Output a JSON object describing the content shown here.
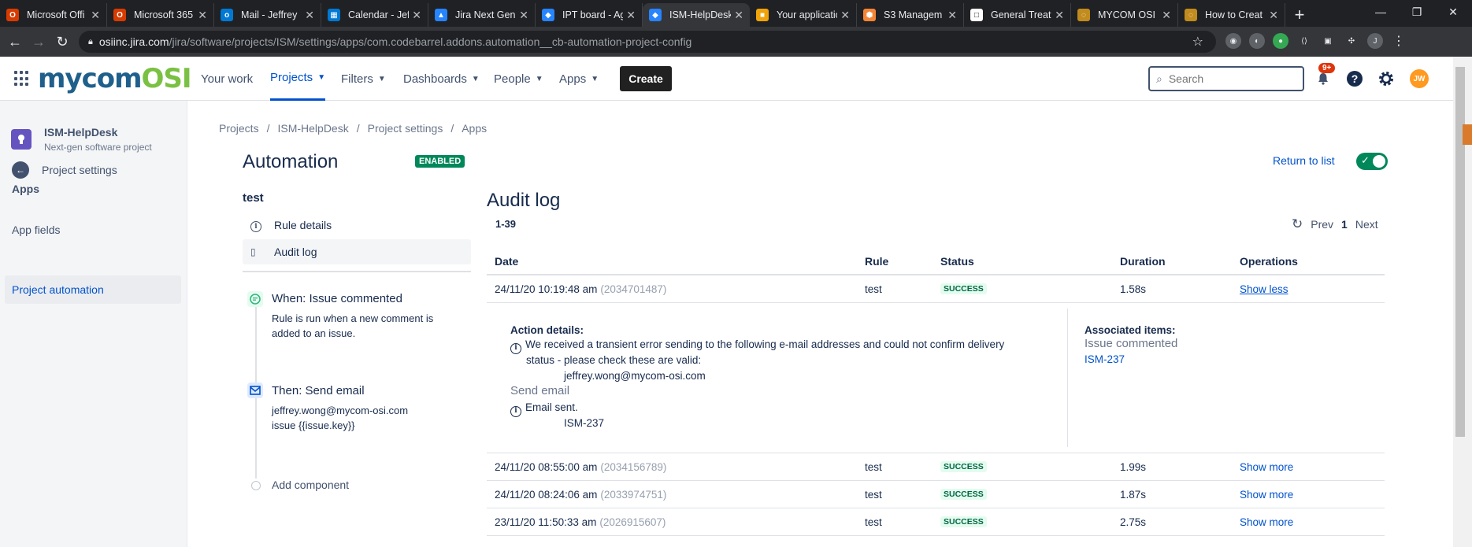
{
  "browser": {
    "tabs": [
      {
        "label": "Microsoft Offi",
        "color": "#d83b01",
        "glyph": "O"
      },
      {
        "label": "Microsoft 365",
        "color": "#d83b01",
        "glyph": "O"
      },
      {
        "label": "Mail - Jeffrey",
        "color": "#0078d4",
        "glyph": "o"
      },
      {
        "label": "Calendar - Jeff",
        "color": "#0078d4",
        "glyph": "▦"
      },
      {
        "label": "Jira Next Gen",
        "color": "#2684ff",
        "glyph": "▲"
      },
      {
        "label": "IPT board - Ag",
        "color": "#2684ff",
        "glyph": "◆"
      },
      {
        "label": "ISM-HelpDesk",
        "color": "#2684ff",
        "glyph": "◆"
      },
      {
        "label": "Your applicatio",
        "color": "#f0a30a",
        "glyph": "■"
      },
      {
        "label": "S3 Managem",
        "color": "#f58536",
        "glyph": "⬢"
      },
      {
        "label": "General Treat",
        "color": "#ffffff",
        "glyph": "□"
      },
      {
        "label": "MYCOM OSI",
        "color": "#c28b1e",
        "glyph": "◌"
      },
      {
        "label": "How to Creat",
        "color": "#c28b1e",
        "glyph": "◌"
      }
    ],
    "active_tab": 6,
    "url_host": "osiinc.jira.com",
    "url_path": "/jira/software/projects/ISM/settings/apps/com.codebarrel.addons.automation__cb-automation-project-config",
    "profile_initial": "J"
  },
  "topnav": {
    "logo_main": "mycom",
    "logo_accent": "OSI",
    "items": [
      "Your work",
      "Projects",
      "Filters",
      "Dashboards",
      "People",
      "Apps"
    ],
    "active_item": "Projects",
    "create_label": "Create",
    "search_placeholder": "Search",
    "notification_badge": "9+",
    "avatar_initials": "JW"
  },
  "sidebar": {
    "project_name": "ISM-HelpDesk",
    "project_type": "Next-gen software project",
    "back_label": "Project settings",
    "section_label": "Apps",
    "items": [
      "App fields",
      "Project automation"
    ],
    "selected_item": "Project automation"
  },
  "breadcrumb": [
    "Projects",
    "ISM-HelpDesk",
    "Project settings",
    "Apps"
  ],
  "automation": {
    "title": "Automation",
    "status_badge": "ENABLED",
    "return_label": "Return to list",
    "enabled": true,
    "rule_name": "test",
    "rule_menu": [
      {
        "label": "Rule details",
        "icon": "info-icon"
      },
      {
        "label": "Audit log",
        "icon": "document-icon"
      }
    ],
    "selected_menu": "Audit log",
    "components": [
      {
        "title": "When: Issue commented",
        "desc_lines": [
          "Rule is run when a new comment is",
          "added to an issue."
        ],
        "icon": "comment-icon",
        "icon_color": "#36b37e",
        "icon_bg": "#e3fcef"
      },
      {
        "title": "Then: Send email",
        "desc_lines": [
          "jeffrey.wong@mycom-osi.com",
          "issue {{issue.key}}"
        ],
        "icon": "email-icon",
        "icon_color": "#0052cc",
        "icon_bg": "#deebff"
      }
    ],
    "add_component_label": "Add component"
  },
  "audit": {
    "title": "Audit log",
    "range": "1-39",
    "prev_label": "Prev",
    "page": "1",
    "next_label": "Next",
    "columns": [
      "Date",
      "Rule",
      "Status",
      "Duration",
      "Operations"
    ],
    "rows": [
      {
        "date": "24/11/20 10:19:48 am",
        "id": "(2034701487)",
        "rule": "test",
        "status": "SUCCESS",
        "duration": "1.58s",
        "op": "Show less"
      },
      {
        "date": "24/11/20 08:55:00 am",
        "id": "(2034156789)",
        "rule": "test",
        "status": "SUCCESS",
        "duration": "1.99s",
        "op": "Show more"
      },
      {
        "date": "24/11/20 08:24:06 am",
        "id": "(2033974751)",
        "rule": "test",
        "status": "SUCCESS",
        "duration": "1.87s",
        "op": "Show more"
      },
      {
        "date": "23/11/20 11:50:33 am",
        "id": "(2026915607)",
        "rule": "test",
        "status": "SUCCESS",
        "duration": "2.75s",
        "op": "Show more"
      }
    ],
    "detail": {
      "action_label": "Action details:",
      "warning_line1": "We received a transient error sending to the following e-mail addresses and could not confirm delivery",
      "warning_line2": "status - please check these are valid:",
      "email": "jeffrey.wong@mycom-osi.com",
      "send_email_label": "Send email",
      "sent_label": "Email sent.",
      "issue_key": "ISM-237",
      "associated_label": "Associated items:",
      "associated_type": "Issue commented",
      "associated_link": "ISM-237"
    }
  }
}
